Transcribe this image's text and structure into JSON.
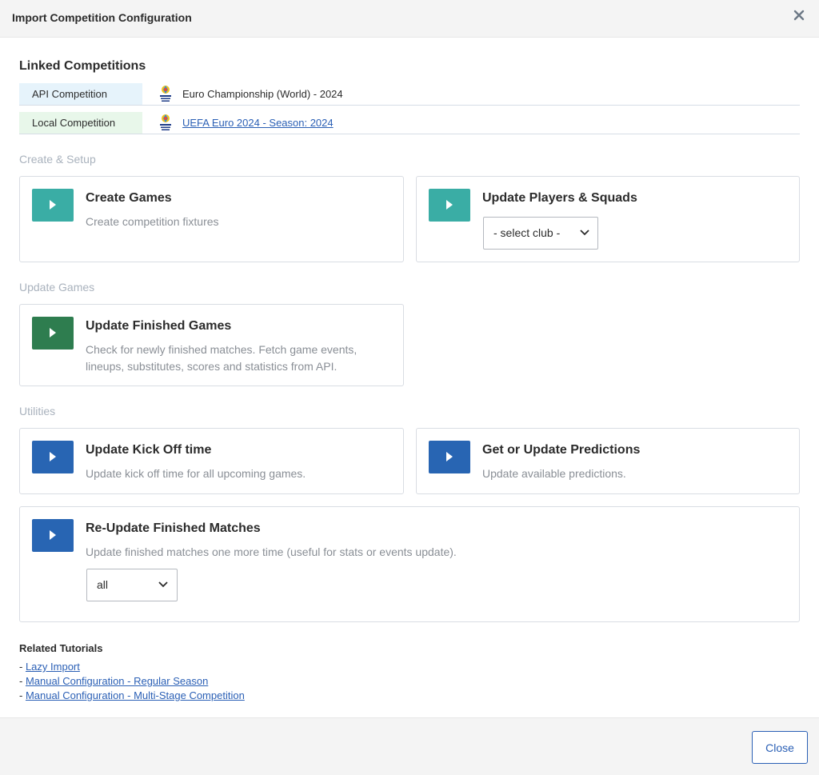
{
  "modal": {
    "title": "Import Competition Configuration",
    "close_icon": "close-icon"
  },
  "linked": {
    "heading": "Linked Competitions",
    "api": {
      "label": "API Competition",
      "value": "Euro Championship (World) - 2024",
      "icon": "competition-logo-icon"
    },
    "local": {
      "label": "Local Competition",
      "value": "UEFA Euro 2024 - Season: 2024",
      "icon": "competition-logo-icon"
    }
  },
  "groups": {
    "create_setup": "Create & Setup",
    "update_games": "Update Games",
    "utilities": "Utilities"
  },
  "cards": {
    "create_games": {
      "title": "Create Games",
      "desc": "Create competition fixtures"
    },
    "update_players": {
      "title": "Update Players & Squads",
      "select_value": "- select club -"
    },
    "update_finished": {
      "title": "Update Finished Games",
      "desc": "Check for newly finished matches. Fetch game events, lineups, substitutes, scores and statistics from API."
    },
    "update_kickoff": {
      "title": "Update Kick Off time",
      "desc": "Update kick off time for all upcoming games."
    },
    "predictions": {
      "title": "Get or Update Predictions",
      "desc": "Update available predictions."
    },
    "reupdate": {
      "title": "Re-Update Finished Matches",
      "desc": "Update finished matches one more time (useful for stats or events update).",
      "select_value": "all"
    }
  },
  "tutorials": {
    "heading": "Related Tutorials",
    "prefix": "- ",
    "items": [
      "Lazy Import",
      "Manual Configuration - Regular Season",
      "Manual Configuration - Multi-Stage Competition"
    ]
  },
  "footer": {
    "close_label": "Close"
  },
  "colors": {
    "teal": "#3aada5",
    "green": "#2e7d4f",
    "blue": "#2865b3",
    "link": "#2a5fb5"
  }
}
